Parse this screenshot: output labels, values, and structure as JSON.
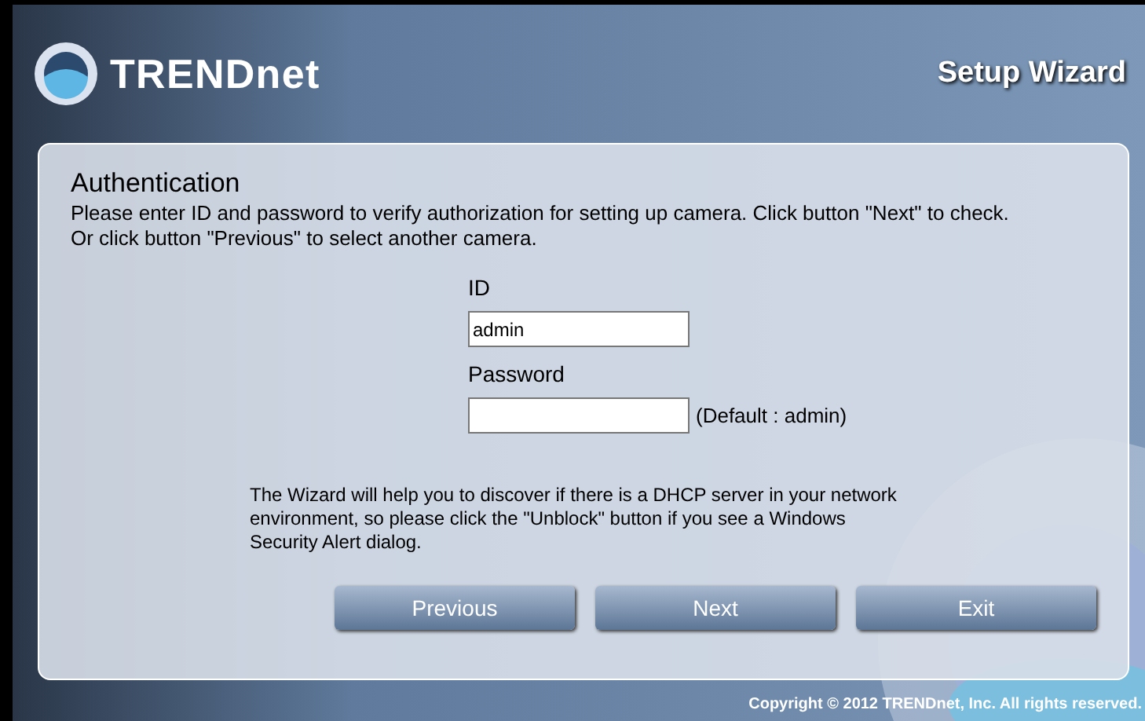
{
  "header": {
    "logo_text": "TRENDnet",
    "title": "Setup Wizard"
  },
  "panel": {
    "heading": "Authentication",
    "instructions": [
      "Please enter ID and password to verify authorization for setting up camera. Click button \"Next\" to check.",
      "Or click button \"Previous\" to select another camera."
    ],
    "fields": [
      {
        "label": "ID",
        "value": "admin"
      },
      {
        "label": "Password",
        "hint": "(Default : admin)"
      }
    ],
    "note": "The Wizard will help you to discover if there is a DHCP server in your network environment, so please click the \"Unblock\" button if you see a Windows Security Alert dialog.",
    "buttons": [
      "Previous",
      "Next",
      "Exit"
    ]
  },
  "footer": "Copyright © 2012 TRENDnet, Inc. All rights reserved."
}
